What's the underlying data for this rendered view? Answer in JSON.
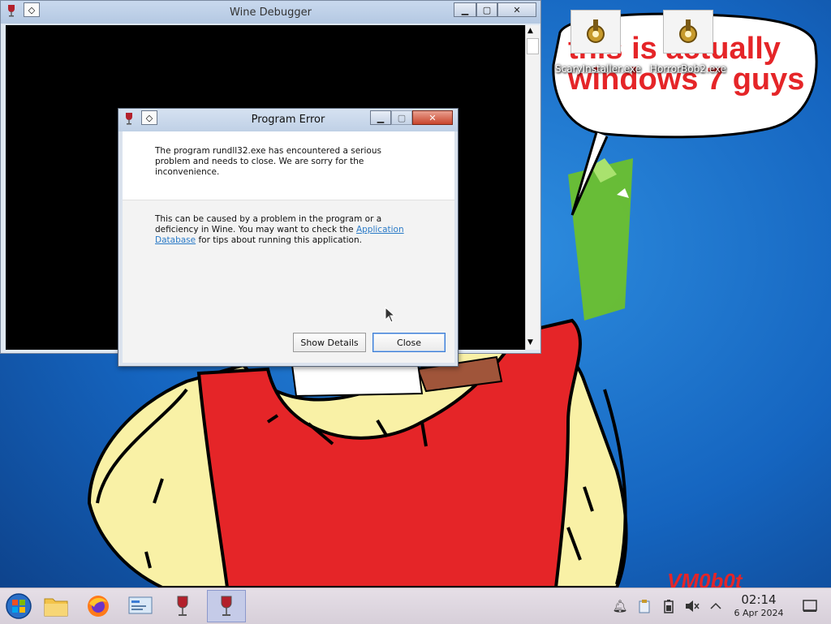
{
  "wallpaper": {
    "speech_text_line1": "this is actually",
    "speech_text_line2": "windows 7 guys",
    "signature": "VM0b0t"
  },
  "desktop_icons": [
    {
      "label": "ScaryInstaller.exe",
      "icon": "installer-gear-icon"
    },
    {
      "label": "HorrorBob2.exe",
      "icon": "installer-gear-icon"
    }
  ],
  "debugger_window": {
    "title": "Wine Debugger"
  },
  "error_dialog": {
    "title": "Program Error",
    "message_primary": "The program rundll32.exe has encountered a serious problem and needs to close. We are sorry for the inconvenience.",
    "message_secondary_before": "This can be caused by a problem in the program or a deficiency in Wine. You may want to check the",
    "link_text": "Application Database",
    "message_secondary_after": "for tips about running this application.",
    "show_details_label": "Show Details",
    "close_label": "Close"
  },
  "taskbar": {
    "items": [
      "start-orb-icon",
      "file-manager-icon",
      "firefox-icon",
      "control-panel-icon",
      "wine-glass-icon",
      "wine-glass-icon"
    ],
    "clock_time": "02:14",
    "clock_date": "6 Apr 2024",
    "tray_icons": [
      "notification-bell-icon",
      "clipboard-icon",
      "battery-icon",
      "volume-muted-icon",
      "chevron-up-icon",
      "show-desktop-icon"
    ]
  },
  "colors": {
    "link": "#2a7ac7",
    "doodle_red": "#e52528",
    "doodle_skin": "#f9f1a6"
  }
}
